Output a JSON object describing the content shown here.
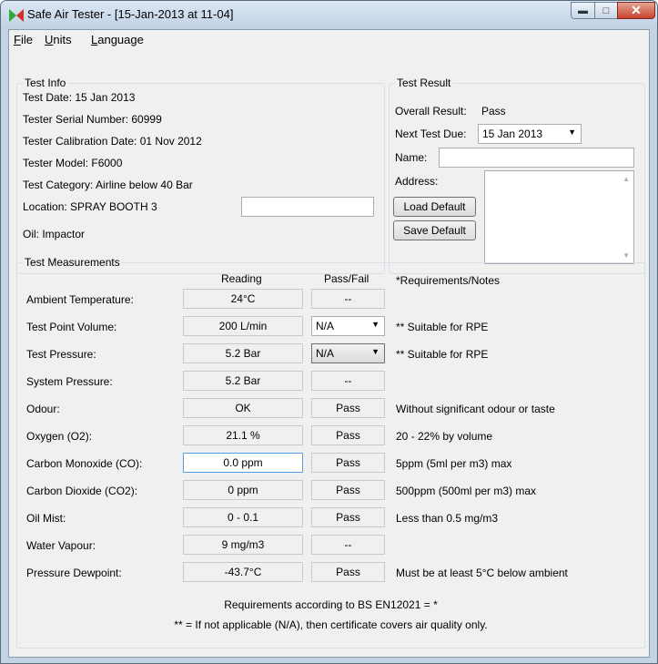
{
  "window": {
    "title": "Safe Air Tester - [15-Jan-2013 at 11-04]"
  },
  "menu": [
    "File",
    "Units",
    "Language"
  ],
  "test_info": {
    "title": "Test Info",
    "test_date": "Test Date:   15 Jan 2013",
    "serial": "Tester Serial Number:   60999",
    "calibration": "Tester Calibration Date:   01 Nov 2012",
    "model": "Tester Model:    F6000",
    "category": "Test Category:   Airline below 40 Bar",
    "location": "Location:   SPRAY BOOTH 3",
    "location_value": "",
    "oil": "Oil:   Impactor"
  },
  "test_result": {
    "title": "Test Result",
    "overall_label": "Overall Result:",
    "overall_value": "Pass",
    "next_label": "Next Test Due:",
    "next_value": "15 Jan 2013",
    "name_label": "Name:",
    "name_value": "",
    "address_label": "Address:",
    "address_value": "",
    "load_default": "Load Default",
    "save_default": "Save Default"
  },
  "measurements": {
    "title": "Test Measurements",
    "headers": {
      "reading": "Reading",
      "passfail": "Pass/Fail",
      "notes": "*Requirements/Notes"
    },
    "rows": [
      {
        "label": "Ambient Temperature:",
        "reading": "24°C",
        "passfail": "--",
        "notes": ""
      },
      {
        "label": "Test Point Volume:",
        "reading": "200 L/min",
        "passfail": "N/A",
        "notes": "** Suitable for RPE"
      },
      {
        "label": "Test Pressure:",
        "reading": "5.2 Bar",
        "passfail": "N/A",
        "notes": "** Suitable for RPE"
      },
      {
        "label": "System Pressure:",
        "reading": "5.2 Bar",
        "passfail": "--",
        "notes": ""
      },
      {
        "label": "Odour:",
        "reading": "OK",
        "passfail": "Pass",
        "notes": "Without significant odour or taste"
      },
      {
        "label": "Oxygen (O2):",
        "reading": "21.1 %",
        "passfail": "Pass",
        "notes": "20 - 22% by volume"
      },
      {
        "label": "Carbon Monoxide (CO):",
        "reading": "0.0 ppm",
        "passfail": "Pass",
        "notes": "5ppm (5ml per m3) max"
      },
      {
        "label": "Carbon Dioxide (CO2):",
        "reading": "0 ppm",
        "passfail": "Pass",
        "notes": "500ppm (500ml per m3) max"
      },
      {
        "label": "Oil Mist:",
        "reading": "0 - 0.1",
        "passfail": "Pass",
        "notes": "Less than 0.5 mg/m3"
      },
      {
        "label": "Water Vapour:",
        "reading": "9 mg/m3",
        "passfail": "--",
        "notes": ""
      },
      {
        "label": "Pressure Dewpoint:",
        "reading": "-43.7°C",
        "passfail": "Pass",
        "notes": "Must be at least 5°C below ambient"
      }
    ],
    "footer1": "Requirements according to BS EN12021 = *",
    "footer2": "** = If not applicable (N/A), then certificate covers air quality only."
  }
}
